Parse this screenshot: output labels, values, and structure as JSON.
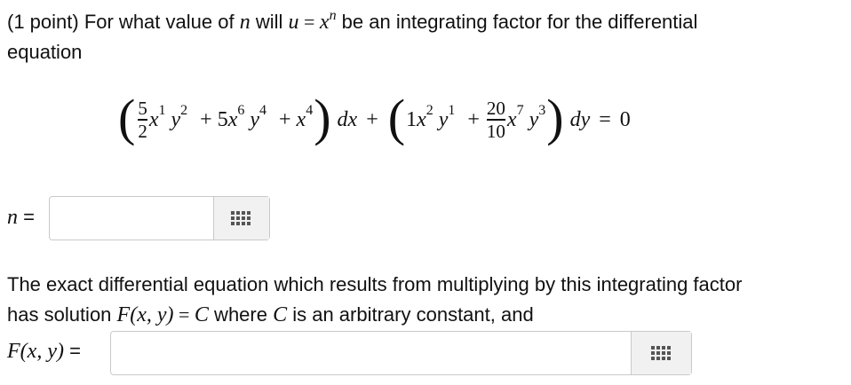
{
  "problem": {
    "prefix": "(1 point) For what value of",
    "var_n": "n",
    "will": " will ",
    "var_u": "u",
    "equals": " = ",
    "var_x": "x",
    "exp_n": "n",
    "suffix_line1": " be an integrating factor for the differential",
    "line2": "equation"
  },
  "equation": {
    "open_paren_1": "(",
    "frac1_num": "5",
    "frac1_den": "2",
    "term1_x": "x",
    "term1_x_exp": "1",
    "term1_y": "y",
    "term1_y_exp": "2",
    "plus1": "+",
    "coef2": "5",
    "term2_x": "x",
    "term2_x_exp": "6",
    "term2_y": "y",
    "term2_y_exp": "4",
    "plus2": "+",
    "term3_x": "x",
    "term3_x_exp": "4",
    "close_paren_1": ")",
    "dx": "dx",
    "plus3": "+",
    "open_paren_2": "(",
    "coef4": "1",
    "term4_x": "x",
    "term4_x_exp": "2",
    "term4_y": "y",
    "term4_y_exp": "1",
    "plus4": "+",
    "frac2_num": "20",
    "frac2_den": "10",
    "term5_x": "x",
    "term5_x_exp": "7",
    "term5_y": "y",
    "term5_y_exp": "3",
    "close_paren_2": ")",
    "dy": "dy",
    "equals": "=",
    "rhs": "0"
  },
  "answer1": {
    "label_var": "n",
    "label_equals": " =",
    "value": "",
    "button_icon": "grid-icon"
  },
  "statement": {
    "line1": "The exact differential equation which results from multiplying by this integrating factor",
    "line2_prefix": "has solution ",
    "F": "F",
    "args": "(x, y)",
    "equals": " = ",
    "C": "C",
    "where": " where ",
    "C2": "C",
    "suffix": " is an arbitrary constant, and"
  },
  "answer2": {
    "label_F": "F",
    "label_args": "(x, y)",
    "label_equals": " =",
    "value": "",
    "button_icon": "grid-icon"
  }
}
